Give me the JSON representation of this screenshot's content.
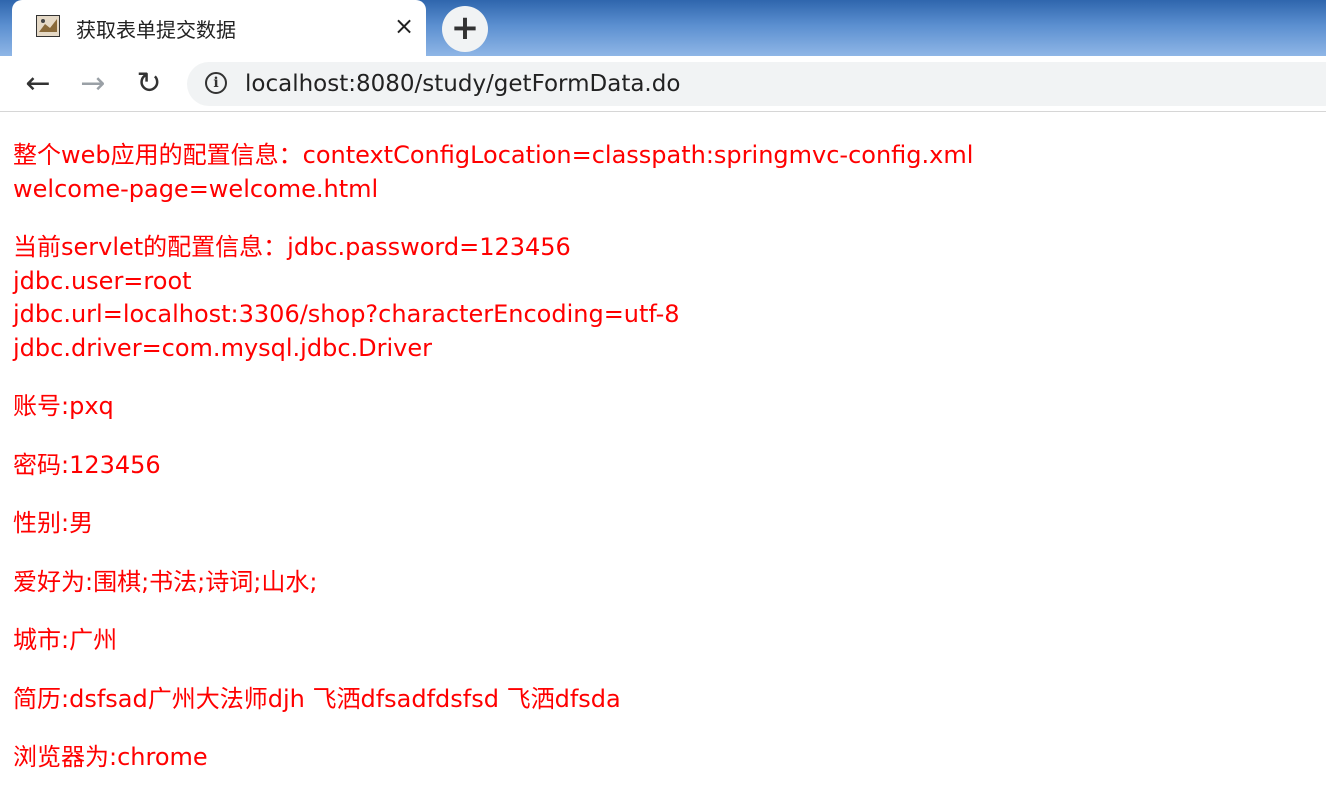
{
  "browser": {
    "tab_title": "获取表单提交数据",
    "tab_close_icon": "close-icon",
    "new_tab_label": "+",
    "url": "localhost:8080/study/getFormData.do",
    "back_label": "←",
    "forward_label": "→",
    "reload_label": "↻",
    "info_label": "i"
  },
  "page": {
    "context_config": "整个web应用的配置信息：contextConfigLocation=classpath:springmvc-config.xml",
    "context_welcome": "welcome-page=welcome.html",
    "servlet_config": "当前servlet的配置信息：jdbc.password=123456",
    "servlet_user": "jdbc.user=root",
    "servlet_url": "jdbc.url=localhost:3306/shop?characterEncoding=utf-8",
    "servlet_driver": "jdbc.driver=com.mysql.jdbc.Driver",
    "account": "账号:pxq",
    "password": "密码:123456",
    "gender": "性别:男",
    "hobbies": "爱好为:围棋;书法;诗词;山水;",
    "city": "城市:广州",
    "resume": "简历:dsfsad广州大法师djh 飞洒dfsadfdsfsd 飞洒dfsda",
    "browser_info": "浏览器为:chrome"
  },
  "colors": {
    "text": "#ff0000",
    "tabbar": "#5b8fd0"
  }
}
